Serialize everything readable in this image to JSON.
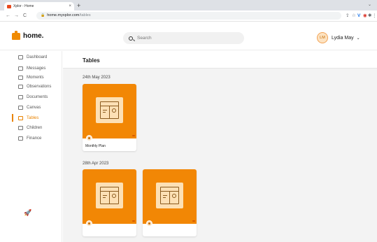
{
  "browser": {
    "tab_title": "Xplor - Home",
    "tab_close": "×",
    "new_tab": "+",
    "tab_menu": "⌄",
    "url_host": "home.myxplor.com",
    "url_path": "/tables",
    "back": "←",
    "forward": "→",
    "reload": "C",
    "lock": "🔒",
    "extensions": [
      "⇪",
      "☆",
      "V",
      "◉",
      "✱",
      "◫",
      "N",
      "⋮"
    ]
  },
  "app": {
    "logo_text": "home.",
    "search": {
      "placeholder": "Search"
    },
    "user": {
      "initials": "LM",
      "name": "Lydia May",
      "chevron": "⌄"
    }
  },
  "sidebar": {
    "active_index": 6,
    "items": [
      {
        "label": "Dashboard",
        "icon": "dashboard-icon"
      },
      {
        "label": "Messages",
        "icon": "messages-icon"
      },
      {
        "label": "Moments",
        "icon": "moments-icon"
      },
      {
        "label": "Observations",
        "icon": "observations-icon"
      },
      {
        "label": "Documents",
        "icon": "documents-icon"
      },
      {
        "label": "Canvas",
        "icon": "canvas-icon"
      },
      {
        "label": "Tables",
        "icon": "tables-icon"
      },
      {
        "label": "Children",
        "icon": "children-icon"
      },
      {
        "label": "Finance",
        "icon": "finance-icon"
      }
    ],
    "footer_icon": "rocket-icon"
  },
  "main": {
    "title": "Tables",
    "sections": [
      {
        "date": "24th May 2023",
        "cards": [
          {
            "label": "Monthly Plan"
          }
        ]
      },
      {
        "date": "28th Apr 2023",
        "cards": [
          {
            "label": ""
          },
          {
            "label": ""
          }
        ]
      }
    ]
  },
  "colors": {
    "accent": "#f28705",
    "active": "#e98300",
    "background": "#f3f3f3"
  }
}
